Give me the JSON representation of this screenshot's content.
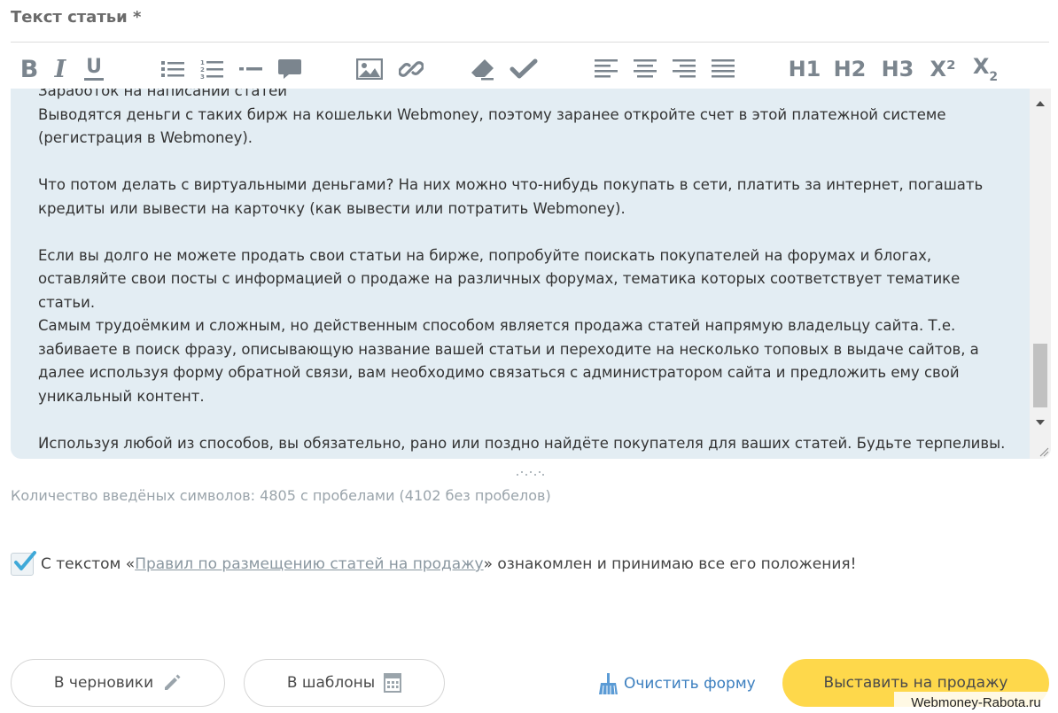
{
  "field": {
    "label": "Текст статьи *"
  },
  "toolbar": {
    "bold": "B",
    "italic": "I",
    "underline": "U",
    "h1": "H1",
    "h2": "H2",
    "h3": "H3",
    "superscript": "X²",
    "subscript_base": "X",
    "subscript_index": "2",
    "icons": [
      "bold-icon",
      "italic-icon",
      "underline-icon",
      "bullet-list-icon",
      "numbered-list-icon",
      "horizontal-rule-icon",
      "comment-icon",
      "image-icon",
      "link-icon",
      "eraser-icon",
      "checkmark-icon",
      "align-left-icon",
      "align-center-icon",
      "align-right-icon",
      "align-justify-icon"
    ]
  },
  "editor": {
    "text": "Заработок на написании статей\nВыводятся деньги с таких бирж на кошельки Webmoney, поэтому заранее откройте счет в этой платежной системе\n(регистрация в Webmoney).\n\nЧто потом делать с виртуальными деньгами? На них можно что-нибудь покупать в сети, платить за интернет, погашать\nкредиты или вывести на карточку (как вывести или потратить Webmoney).\n\nЕсли вы долго не можете продать свои статьи на бирже, попробуйте поискать покупателей на форумах и блогах,\nоставляйте свои посты с информацией о продаже на различных форумах, тематика которых соответствует тематике\nстатьи.\nСамым трудоёмким и сложным, но действенным способом является продажа статей напрямую владельцу сайта. Т.е.\nзабиваете в поиск фразу, описывающую название вашей статьи и переходите на несколько топовых в выдаче сайтов, а\nдалее используя форму обратной связи, вам необходимо связаться с администратором сайта и предложить ему свой\nуникальный контент.\n\nИспользуя любой из способов, вы обязательно, рано или поздно найдёте покупателя для ваших статей. Будьте терпеливы."
  },
  "char_count": "Количество введёных символов: 4805 с пробелами (4102 без пробелов)",
  "agreement": {
    "checked": true,
    "prefix": "С текстом «",
    "link": "Правил по размещению статей на продажу",
    "suffix": "» ознакомлен и принимаю все его положения!"
  },
  "actions": {
    "drafts": "В черновики",
    "templates": "В шаблоны",
    "clear": "Очистить форму",
    "sell": "Выставить на продажу"
  },
  "watermark": "Webmoney-Rabota.ru",
  "colors": {
    "accent_yellow": "#fed84b",
    "link_blue": "#3c7fbf",
    "editor_bg": "#e3edf3",
    "icon_gray": "#7b858e"
  }
}
